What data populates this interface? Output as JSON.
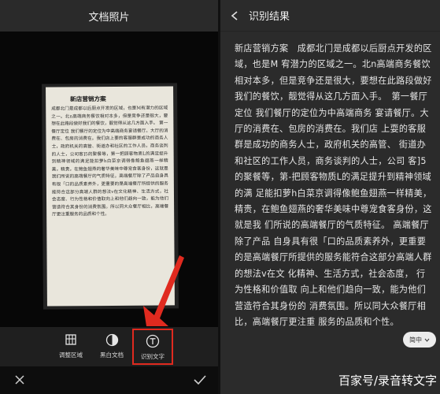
{
  "left": {
    "header_title": "文档照片",
    "paper": {
      "title": "新店营销方案",
      "body": "成都北门是成都以后厨点开发的区域，也是M有潜力的区域之一。北n高端商务餐饮相对本多，但是竞争还是很大，要想在此路段做好我们的餐饮，靓觉得从这几方面入手。 第一餐厅定位 我们餐厅的定位为中高端商务宴请餐厅。大厅的消费在、包房的消费在。我们店上要的客服群是成功的商务人士，政府机关的高管、街道办和社区的工作人员，商务谈判的人士，公司客]5的聚餐等，第一把顾客物质L的满足提升到精神领域的满足能扣萝h白菜京调得像鲍鱼翅燕一样精美，精贵，在鲍鱼翅燕的奢华美味中尊宠食客身份，这就是我们所说的高端餐厅的气质特征。高端餐厅除了产品自身具有很「口的品质素养外，更重要的是高端餐厅所提供的服务能符合这部分高端人群的想法v在文化精神、生活方式，社会态度、行为性格和价值取向上和他们趋向一致，能为他们营造符合其身份的消费氛围。所以同大众餐厅相比，高端餐厅更注重服务的品质和个性。"
    },
    "toolbar": {
      "crop_label": "调整区域",
      "bw_label": "黑白文档",
      "ocr_label": "识别文字"
    }
  },
  "right": {
    "header_title": "识别结果",
    "result_text": "新店营销方案　成都北门是成都以后厨点开发的区域，也是M 宥潜力的区域之一。北n高端商务餐饮相对本多，但是竞争还是很大，要想在此路段做好我们的餐饮，靓觉得从这几方面入手。　第一餐厅定位 我们餐厅的定位为中高端商务 宴请餐厅。大厅的消费在、包房的消费在。我们店 上耍的客服群是成功的商务人士，政府机关的高管、 街道办和社区的工作人员，商务谈判的人士，公司 客]5的聚餐等，第-把顾客物质L的满足提升到精神领域的满 足能扣萝h白菜京调得像鲍鱼翅燕一样精美，精贵，在鲍鱼翅燕的奢华美味中尊宠食客身份，这就是我 们所说的高端餐厅的气质特征。 高端餐厅除了产品 自身具有很「口的品质素养外，更重要的是高端餐厅所提供的服务能符合这部分高端人群的想法v在文 化精神、生活方式，社会态度， 行为性格和价值取 向上和他们趋向一致，能为他们营造符合其身份的 消费氛围。所以同大众餐厅相比，高端餐厅更注重 服务的品质和个性。",
    "lang_label": "简中"
  },
  "watermark": "百家号/录音转文字",
  "colors": {
    "highlight": "#e02a1f",
    "arrow": "#e02a1f"
  },
  "icons": {
    "crop": "crop-grid-icon",
    "bw": "half-circle-icon",
    "ocr": "text-t-icon",
    "close": "close-icon",
    "confirm": "check-icon",
    "back": "chevron-left-icon",
    "dropdown": "chevron-down-icon"
  }
}
